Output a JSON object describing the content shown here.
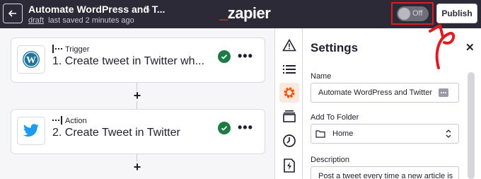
{
  "header": {
    "zap_title": "Automate WordPress and T...",
    "draft_label": "draft",
    "saved_text": "last saved 2 minutes ago",
    "logo": "zapier",
    "toggle_label": "Off",
    "publish_label": "Publish"
  },
  "steps": [
    {
      "kind": "Trigger",
      "title": "1. Create tweet in Twitter wh...",
      "app": "wordpress-icon"
    },
    {
      "kind": "Action",
      "title": "2. Create Tweet in Twitter",
      "app": "twitter-icon"
    }
  ],
  "rail": [
    "warning-icon",
    "list-icon",
    "gear-icon",
    "layers-icon",
    "clock-icon",
    "bolt-file-icon"
  ],
  "settings": {
    "title": "Settings",
    "name_label": "Name",
    "name_value": "Automate WordPress and Twitter",
    "folder_label": "Add To Folder",
    "folder_value": "Home",
    "description_label": "Description",
    "description_value": "Post a tweet every time a new article is"
  },
  "colors": {
    "header_bg": "#2b2a36",
    "brand": "#ff4f00",
    "success": "#1d7c45",
    "annotation": "#e21b23"
  }
}
